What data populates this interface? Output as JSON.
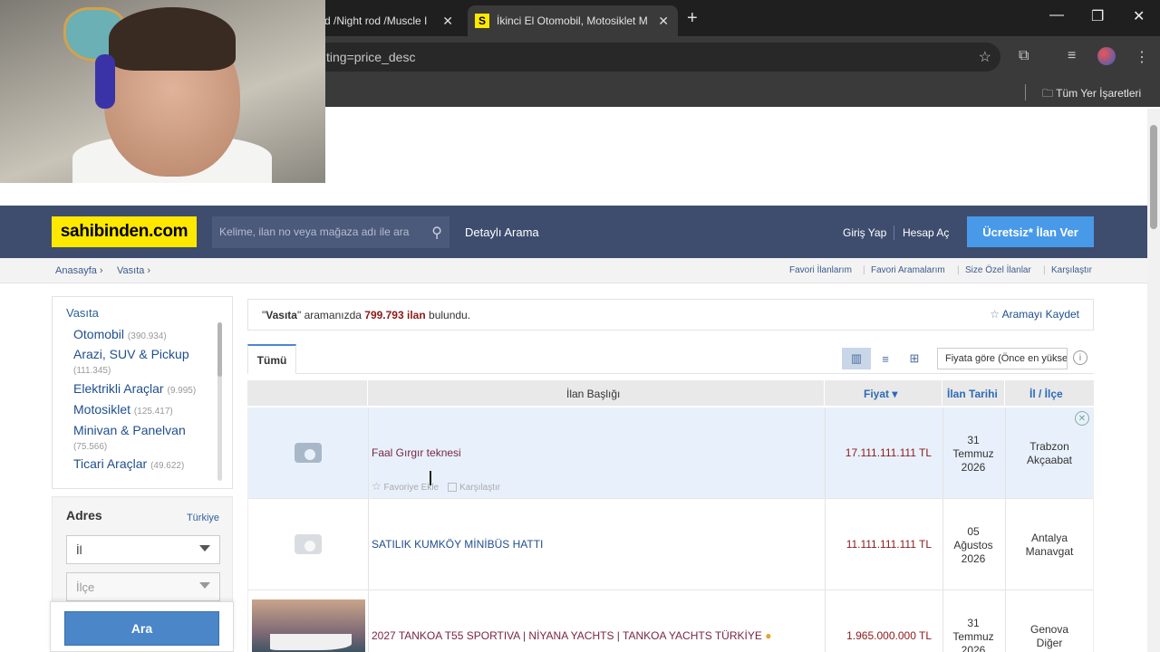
{
  "browser": {
    "tabs": [
      {
        "title": "d /Night rod /Muscle I"
      },
      {
        "title": "İkinci El Otomobil, Motosiklet M",
        "favicon": "S"
      }
    ],
    "url_fragment": "ting=price_desc",
    "bookmarks_label": "Tüm Yer İşaretleri"
  },
  "header": {
    "logo": "sahibinden.com",
    "search_placeholder": "Kelime, ilan no veya mağaza adı ile ara",
    "advanced_search": "Detaylı Arama",
    "login": "Giriş Yap",
    "register": "Hesap Aç",
    "post_ad": "Ücretsiz* İlan Ver"
  },
  "breadcrumb": [
    "Anasayfa",
    "Vasıta"
  ],
  "top_links": [
    "Favori İlanlarım",
    "Favori Aramalarım",
    "Size Özel İlanlar",
    "Karşılaştır"
  ],
  "sidebar": {
    "root": "Vasıta",
    "categories": [
      {
        "name": "Otomobil",
        "count": "(390.934)"
      },
      {
        "name": "Arazi, SUV & Pickup",
        "count": "(111.345)"
      },
      {
        "name": "Elektrikli Araçlar",
        "count": "(9.995)"
      },
      {
        "name": "Motosiklet",
        "count": "(125.417)"
      },
      {
        "name": "Minivan & Panelvan",
        "count": "(75.566)"
      },
      {
        "name": "Ticari Araçlar",
        "count": "(49.622)"
      }
    ],
    "address_title": "Adres",
    "country": "Türkiye",
    "il_placeholder": "İl",
    "ilce_placeholder": "İlçe",
    "search_button": "Ara"
  },
  "results": {
    "query": "Vasıta",
    "prefix": "aramanızda",
    "count": "799.793 ilan",
    "suffix": "bulundu.",
    "save_search": "Aramayı Kaydet",
    "tab_all": "Tümü",
    "sort": "Fiyata göre (Önce en yüksek)",
    "columns": {
      "title": "İlan Başlığı",
      "price": "Fiyat",
      "date": "İlan Tarihi",
      "location": "İl / İlçe"
    },
    "favorite_label": "Favoriye Ekle",
    "compare_label": "Karşılaştır",
    "rows": [
      {
        "title": "Faal Gırgır teknesi",
        "price": "17.111.111.111 TL",
        "day": "31",
        "month": "Temmuz",
        "year": "2026",
        "city": "Trabzon",
        "district": "Akçaabat"
      },
      {
        "title": "SATILIK KUMKÖY MİNİBÜS HATTI",
        "price": "11.111.111.111 TL",
        "day": "05",
        "month": "Ağustos",
        "year": "2026",
        "city": "Antalya",
        "district": "Manavgat"
      },
      {
        "title": "2027 TANKOA T55 SPORTIVA | NİYANA YACHTS | TANKOA YACHTS TÜRKİYE",
        "price": "1.965.000.000 TL",
        "day": "31",
        "month": "Temmuz",
        "year": "2026",
        "city": "Genova",
        "district": "Diğer"
      }
    ]
  }
}
